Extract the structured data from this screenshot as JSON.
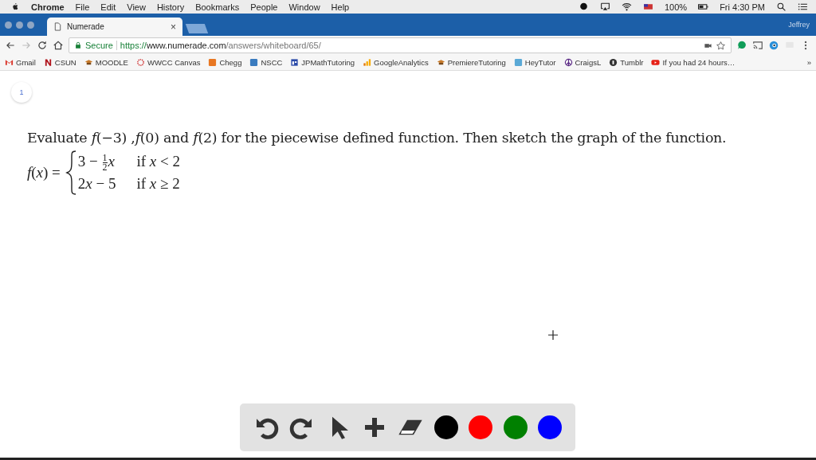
{
  "menu_bar": {
    "app": "Chrome",
    "menus": [
      "File",
      "Edit",
      "View",
      "History",
      "Bookmarks",
      "People",
      "Window",
      "Help"
    ],
    "battery": "100%",
    "clock": "Fri 4:30 PM"
  },
  "tabs": [
    {
      "title": "Numerade",
      "close": "×",
      "selected": true
    }
  ],
  "profile": "Jeffrey",
  "address_bar": {
    "secure_label": "Secure",
    "scheme": "https://",
    "host": "www.numerade.com",
    "path": "/answers/whiteboard/65/"
  },
  "bookmarks": [
    {
      "label": "Gmail",
      "kind": "gmail"
    },
    {
      "label": "CSUN",
      "kind": "letter",
      "color": "#b0121b"
    },
    {
      "label": "MOODLE",
      "kind": "hat"
    },
    {
      "label": "WWCC Canvas",
      "kind": "ring"
    },
    {
      "label": "Chegg",
      "kind": "square",
      "color": "#e87722"
    },
    {
      "label": "NSCC",
      "kind": "square",
      "color": "#3a7bbf"
    },
    {
      "label": "JPMathTutoring",
      "kind": "window"
    },
    {
      "label": "GoogleAnalytics",
      "kind": "bars"
    },
    {
      "label": "PremiereTutoring",
      "kind": "hat"
    },
    {
      "label": "HeyTutor",
      "kind": "square",
      "color": "#5aa9d6"
    },
    {
      "label": "CraigsL",
      "kind": "peace"
    },
    {
      "label": "Tumblr",
      "kind": "circle"
    },
    {
      "label": "If you had 24 hours…",
      "kind": "play"
    }
  ],
  "bookmarks_more": "»",
  "page_badge": "1",
  "question": "Evaluate *f*(−3) ,*f*(0) and *f*(2) for the piecewise defined function. Then sketch the graph of the function.",
  "formula": {
    "lhs": "*f*(*x*) =",
    "cases": [
      {
        "lead": "3 − ",
        "numerator": "1",
        "denominator": "2",
        "tail": "*x*",
        "condition": "if *x* < 2"
      },
      {
        "lead": "2",
        "tail": "*x* − 5",
        "condition": "if *x* ≥ 2"
      }
    ]
  },
  "toolbar": [
    {
      "kind": "undo"
    },
    {
      "kind": "redo"
    },
    {
      "kind": "pointer"
    },
    {
      "kind": "plus"
    },
    {
      "kind": "eraser"
    },
    {
      "kind": "color",
      "color": "#000000"
    },
    {
      "kind": "color",
      "color": "#ff0000"
    },
    {
      "kind": "color",
      "color": "#008000"
    },
    {
      "kind": "color",
      "color": "#0000ff"
    }
  ]
}
